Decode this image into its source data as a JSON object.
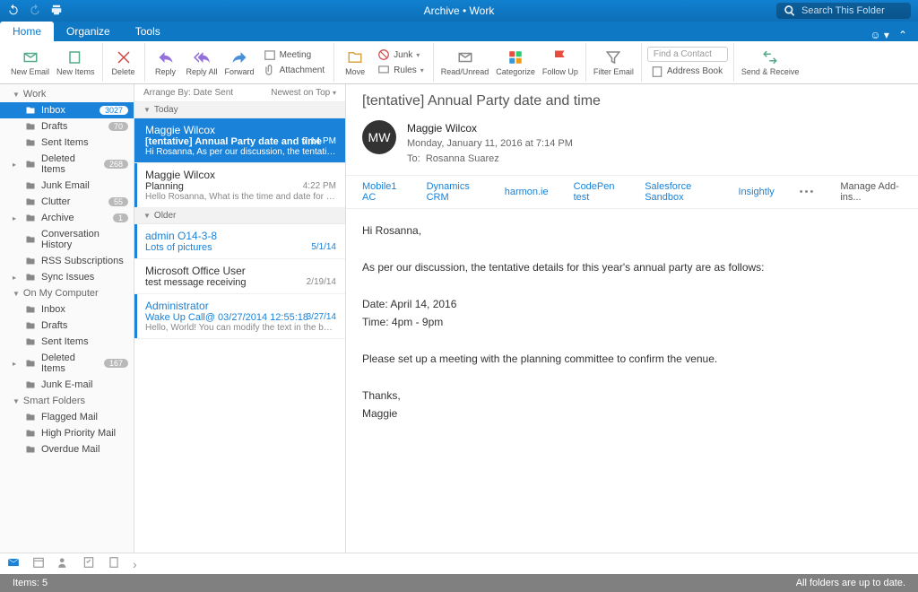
{
  "titlebar": {
    "title": "Archive • Work",
    "search_placeholder": "Search This Folder"
  },
  "tabs": {
    "items": [
      "Home",
      "Organize",
      "Tools"
    ],
    "active": 0
  },
  "ribbon": {
    "new_email": "New\nEmail",
    "new_items": "New\nItems",
    "delete": "Delete",
    "reply": "Reply",
    "reply_all": "Reply\nAll",
    "forward": "Forward",
    "meeting": "Meeting",
    "attachment": "Attachment",
    "move": "Move",
    "junk": "Junk",
    "rules": "Rules",
    "read_unread": "Read/Unread",
    "categorize": "Categorize",
    "follow_up": "Follow\nUp",
    "filter_email": "Filter\nEmail",
    "find_contact": "Find a Contact",
    "address_book": "Address Book",
    "send_receive": "Send &\nReceive"
  },
  "sidebar": {
    "sections": [
      {
        "label": "Work",
        "expanded": true,
        "items": [
          {
            "label": "Inbox",
            "badge": "3027",
            "selected": true,
            "icon": "inbox"
          },
          {
            "label": "Drafts",
            "badge": "70",
            "icon": "draft"
          },
          {
            "label": "Sent Items",
            "icon": "sent"
          },
          {
            "label": "Deleted Items",
            "badge": "268",
            "icon": "trash",
            "caret": true
          },
          {
            "label": "Junk Email",
            "icon": "junk"
          },
          {
            "label": "Clutter",
            "badge": "55",
            "icon": "folder"
          },
          {
            "label": "Archive",
            "badge": "1",
            "icon": "folder",
            "caret": true
          },
          {
            "label": "Conversation History",
            "icon": "folder"
          },
          {
            "label": "RSS Subscriptions",
            "icon": "folder"
          },
          {
            "label": "Sync Issues",
            "icon": "folder",
            "caret": true
          }
        ]
      },
      {
        "label": "On My Computer",
        "expanded": true,
        "items": [
          {
            "label": "Inbox",
            "icon": "inbox"
          },
          {
            "label": "Drafts",
            "icon": "draft"
          },
          {
            "label": "Sent Items",
            "icon": "sent"
          },
          {
            "label": "Deleted Items",
            "badge": "167",
            "icon": "trash",
            "caret": true
          },
          {
            "label": "Junk E-mail",
            "icon": "junk"
          }
        ]
      },
      {
        "label": "Smart Folders",
        "expanded": true,
        "items": [
          {
            "label": "Flagged Mail",
            "icon": "folder"
          },
          {
            "label": "High Priority Mail",
            "icon": "folder"
          },
          {
            "label": "Overdue Mail",
            "icon": "folder"
          }
        ]
      }
    ]
  },
  "list": {
    "arrange_by": "Arrange By: Date Sent",
    "newest": "Newest on Top",
    "groups": [
      {
        "label": "Today",
        "messages": [
          {
            "from": "Maggie Wilcox",
            "subject": "[tentative] Annual Party date and time",
            "preview": "Hi Rosanna, As per our discussion, the tentative detail…",
            "time": "7:14 PM",
            "selected": true,
            "bar": true
          },
          {
            "from": "Maggie Wilcox",
            "subject": "Planning",
            "preview": "Hello Rosanna, What is the time and date for the holid…",
            "time": "4:22 PM",
            "bar": true
          }
        ]
      },
      {
        "label": "Older",
        "messages": [
          {
            "from": "admin O14-3-8",
            "subject": "Lots of pictures",
            "preview": "",
            "time": "5/1/14",
            "link": true,
            "bar": true
          },
          {
            "from": "Microsoft Office User",
            "subject": "test message receiving",
            "preview": "",
            "time": "2/19/14"
          },
          {
            "from": "Administrator",
            "subject": "Wake Up Call@ 03/27/2014 12:55:18",
            "preview": "Hello, World! You can modify the text in the box to the…",
            "time": "3/27/14",
            "link": true,
            "bar": true
          }
        ]
      }
    ]
  },
  "reading": {
    "subject": "[tentative] Annual Party date and time",
    "avatar": "MW",
    "from_name": "Maggie Wilcox",
    "date": "Monday, January 11, 2016 at 7:14 PM",
    "to_label": "To:",
    "to": "Rosanna Suarez",
    "addins": [
      "Mobile1 AC",
      "Dynamics CRM",
      "harmon.ie",
      "CodePen test",
      "Salesforce Sandbox",
      "Insightly"
    ],
    "manage": "Manage Add-ins...",
    "body": "Hi Rosanna,\n\nAs per our discussion, the tentative details for this year's annual party are as follows:\n\nDate: April 14, 2016\nTime: 4pm - 9pm\n\nPlease set up a meeting with the planning committee to confirm the venue.\n\nThanks,\nMaggie"
  },
  "status": {
    "items": "Items: 5",
    "sync": "All folders are up to date."
  }
}
